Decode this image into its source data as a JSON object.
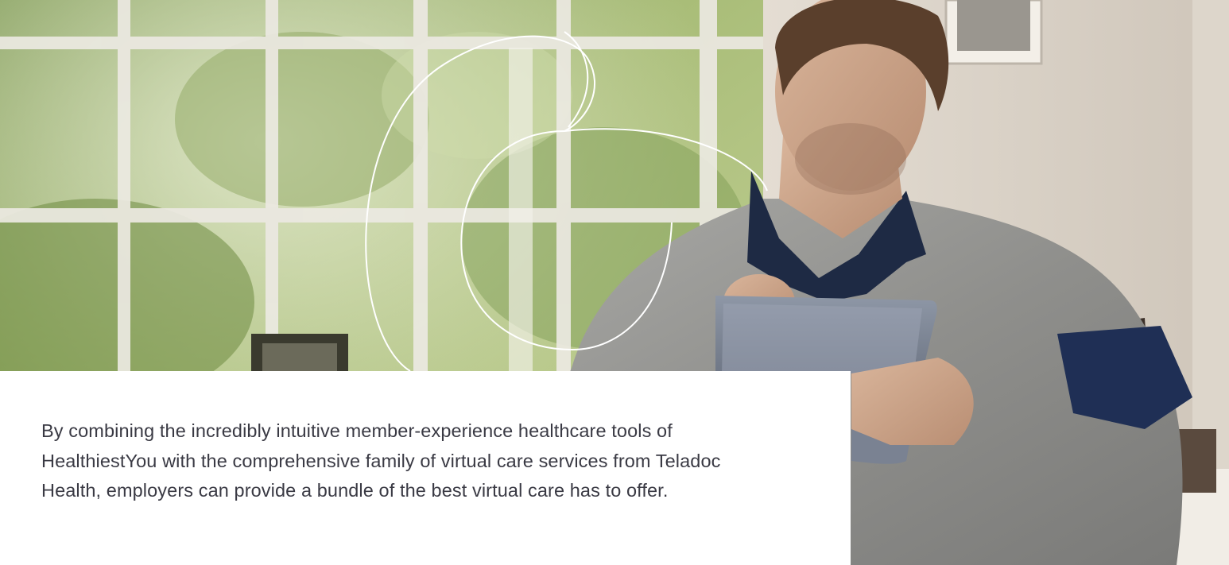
{
  "hero": {
    "image": "man-using-tablet-photo",
    "decoration": "line-art-circles"
  },
  "content": {
    "paragraph": "By combining the incredibly intuitive member-experience healthcare tools of HealthiestYou with the comprehensive family of virtual care services from Teladoc Health, employers can provide a bundle of the best virtual care has to offer."
  },
  "colors": {
    "text": "#3a3a44",
    "panel": "#ffffff",
    "line_art": "#ffffff"
  }
}
